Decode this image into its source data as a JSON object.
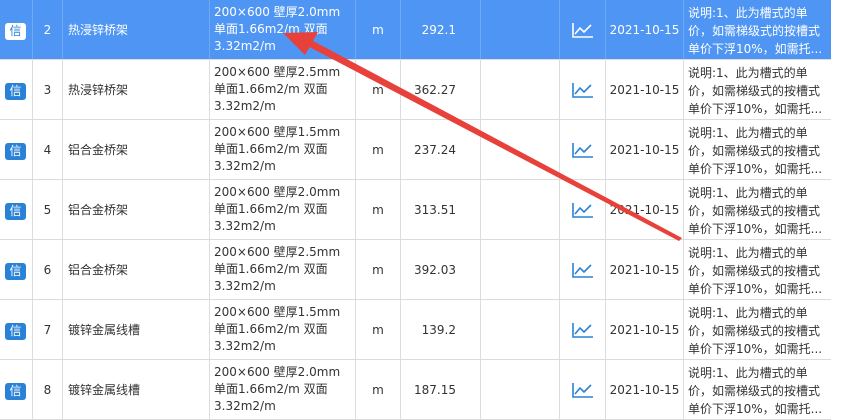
{
  "rows": [
    {
      "badge": "信",
      "no": "2",
      "name": "热浸锌桥架",
      "spec": "200×600 壁厚2.0mm 单面1.66m2/m 双面3.32m2/m",
      "unit": "m",
      "price": "292.1",
      "blank": "",
      "date": "2021-10-15",
      "note": "说明:1、此为槽式的单价，如需梯级式的按槽式单价下浮10%，如需托..."
    },
    {
      "badge": "信",
      "no": "3",
      "name": "热浸锌桥架",
      "spec": "200×600 壁厚2.5mm 单面1.66m2/m 双面3.32m2/m",
      "unit": "m",
      "price": "362.27",
      "blank": "",
      "date": "2021-10-15",
      "note": "说明:1、此为槽式的单价，如需梯级式的按槽式单价下浮10%，如需托..."
    },
    {
      "badge": "信",
      "no": "4",
      "name": "铝合金桥架",
      "spec": "200×600 壁厚1.5mm 单面1.66m2/m 双面3.32m2/m",
      "unit": "m",
      "price": "237.24",
      "blank": "",
      "date": "2021-10-15",
      "note": "说明:1、此为槽式的单价，如需梯级式的按槽式单价下浮10%，如需托..."
    },
    {
      "badge": "信",
      "no": "5",
      "name": "铝合金桥架",
      "spec": "200×600 壁厚2.0mm 单面1.66m2/m 双面3.32m2/m",
      "unit": "m",
      "price": "313.51",
      "blank": "",
      "date": "2021-10-15",
      "note": "说明:1、此为槽式的单价，如需梯级式的按槽式单价下浮10%，如需托..."
    },
    {
      "badge": "信",
      "no": "6",
      "name": "铝合金桥架",
      "spec": "200×600 壁厚2.5mm 单面1.66m2/m 双面3.32m2/m",
      "unit": "m",
      "price": "392.03",
      "blank": "",
      "date": "2021-10-15",
      "note": "说明:1、此为槽式的单价，如需梯级式的按槽式单价下浮10%，如需托..."
    },
    {
      "badge": "信",
      "no": "7",
      "name": "镀锌金属线槽",
      "spec": "200×600 壁厚1.5mm 单面1.66m2/m 双面3.32m2/m",
      "unit": "m",
      "price": "139.2",
      "blank": "",
      "date": "2021-10-15",
      "note": "说明:1、此为槽式的单价，如需梯级式的按槽式单价下浮10%，如需托..."
    },
    {
      "badge": "信",
      "no": "8",
      "name": "镀锌金属线槽",
      "spec": "200×600 壁厚2.0mm 单面1.66m2/m 双面3.32m2/m",
      "unit": "m",
      "price": "187.15",
      "blank": "",
      "date": "2021-10-15",
      "note": "说明:1、此为槽式的单价，如需梯级式的按槽式单价下浮10%，如需托..."
    }
  ],
  "selected_row": 0,
  "icons": {
    "trend": "trend-chart-icon",
    "badge": "info-badge-icon"
  },
  "colors": {
    "selected": "#4f95f3",
    "badge": "#2a82d6",
    "annotation_arrow": "#e8403a"
  }
}
